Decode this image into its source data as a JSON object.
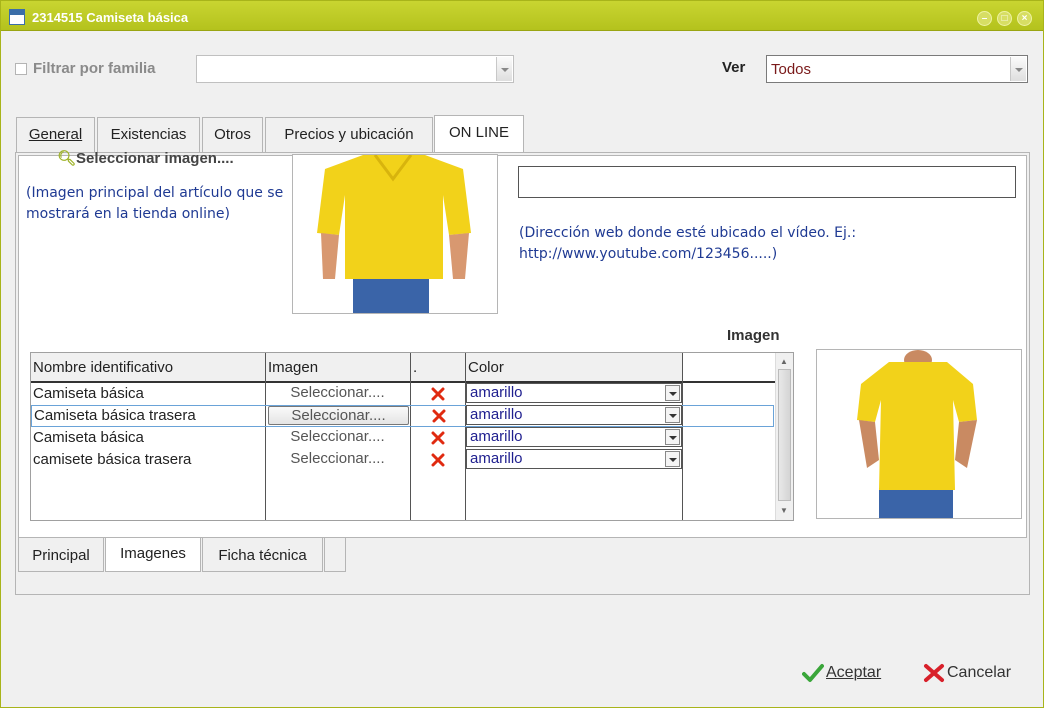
{
  "window": {
    "title": "2314515 Camiseta básica",
    "accent_color": "#b4c21d",
    "controls": [
      "minimize-icon",
      "maximize-icon",
      "close-icon"
    ]
  },
  "filter": {
    "checkbox_label": "Filtrar por familia",
    "family_value": "",
    "ver_label": "Ver",
    "ver_value": "Todos"
  },
  "tabs": [
    {
      "label": "General",
      "active": false
    },
    {
      "label": "Existencias",
      "active": false
    },
    {
      "label": "Otros",
      "active": false
    },
    {
      "label": "Precios y ubicación",
      "active": false
    },
    {
      "label": "ON LINE",
      "active": true
    }
  ],
  "online": {
    "select_image_link": "Seleccionar imagen....",
    "main_image_hint": "(Imagen principal del artículo que se mostrará en la tienda online)",
    "video_url_value": "",
    "video_hint": "(Dirección web donde esté ubicado el vídeo. Ej.: http://www.youtube.com/123456.....)",
    "image_preview_label": "Imagen"
  },
  "images_table": {
    "columns": [
      "Nombre identificativo",
      "Imagen",
      ".",
      "Color"
    ],
    "rows": [
      {
        "name": "Camiseta básica",
        "image_btn": "Seleccionar....",
        "color": "amarillo",
        "selected": false
      },
      {
        "name": "Camiseta básica trasera",
        "image_btn": "Seleccionar....",
        "color": "amarillo",
        "selected": true
      },
      {
        "name": "Camiseta básica",
        "image_btn": "Seleccionar....",
        "color": "amarillo",
        "selected": false
      },
      {
        "name": "camisete básica trasera",
        "image_btn": "Seleccionar....",
        "color": "amarillo",
        "selected": false
      }
    ]
  },
  "bottom_tabs": [
    {
      "label": "Principal",
      "active": false
    },
    {
      "label": "Imagenes",
      "active": true
    },
    {
      "label": "Ficha técnica",
      "active": false
    }
  ],
  "footer": {
    "accept_label": "Aceptar",
    "cancel_label": "Cancelar"
  }
}
